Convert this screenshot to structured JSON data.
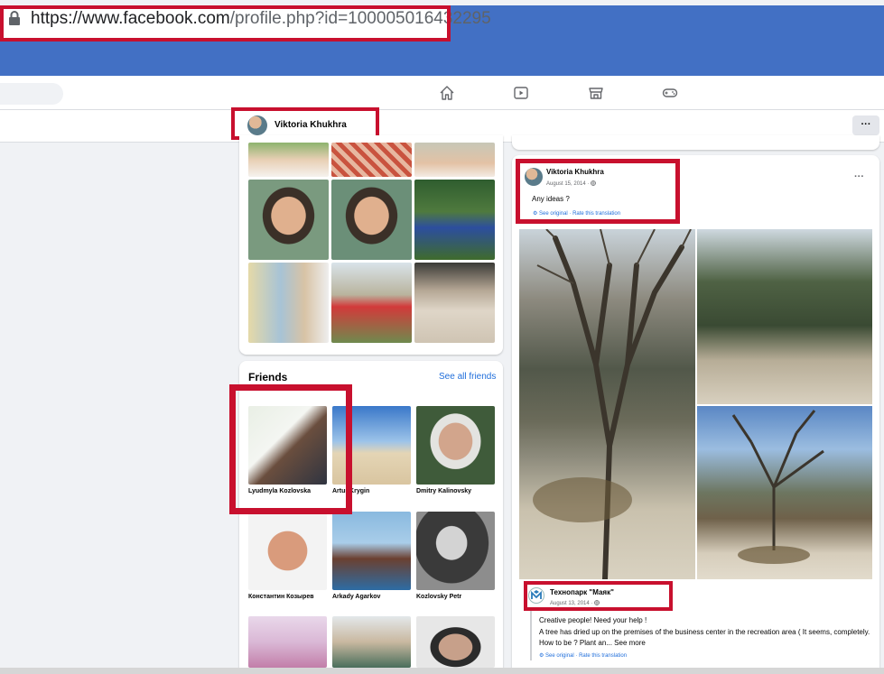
{
  "browser": {
    "url_domain": "https://www.facebook.com",
    "url_path": "/profile.php?id=100005016432295"
  },
  "profile_bar": {
    "name": "Viktoria Khukhra",
    "more_label": "···"
  },
  "friends": {
    "title": "Friends",
    "see_all": "See all friends",
    "items": [
      {
        "name": "Lyudmyla Kozlovska"
      },
      {
        "name": "Artur Krygin"
      },
      {
        "name": "Dmitry Kalinovsky"
      },
      {
        "name": "Константин Козырев"
      },
      {
        "name": "Arkady Agarkov"
      },
      {
        "name": "Kozlovsky Petr"
      }
    ]
  },
  "post": {
    "author": "Viktoria Khukhra",
    "date": "August 15, 2014 · ",
    "text": "Any ideas ?",
    "translation": "See original · Rate this translation",
    "more_label": "···"
  },
  "shared": {
    "name": "Технопарк \"Маяк\"",
    "date": "August 13, 2014 · ",
    "line1": "Creative people! Need your help !",
    "line2": "A tree has dried up on the premises of the business center in the recreation area ( It seems, completely. How to be ? Plant an... See more",
    "translation": "See original · Rate this translation"
  },
  "colors": {
    "highlight": "#c8102e",
    "facebook_blue": "#216fdb",
    "browser_blue": "#4270c4"
  },
  "icons": [
    "lock-icon",
    "home-icon",
    "watch-icon",
    "marketplace-icon",
    "gaming-icon",
    "globe-icon"
  ]
}
